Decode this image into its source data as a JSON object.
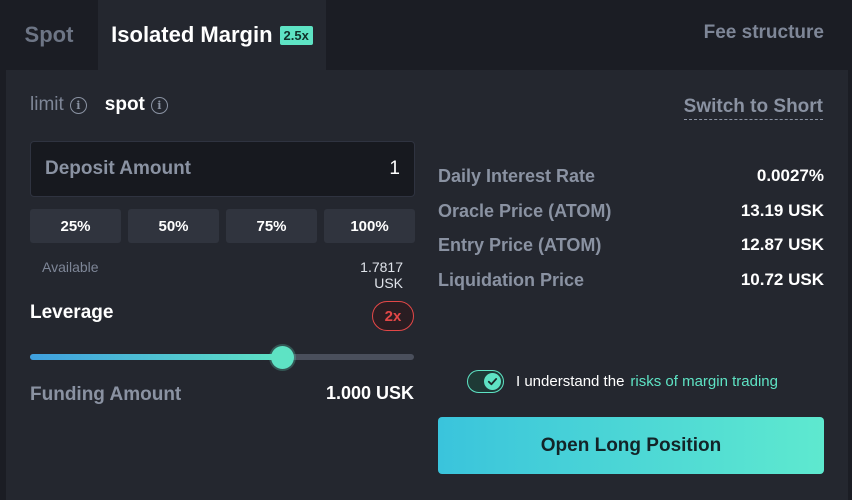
{
  "tabs": {
    "spot": "Spot",
    "isolated_margin": "Isolated Margin",
    "margin_badge": "2.5x",
    "fee_structure": "Fee structure"
  },
  "order_modes": {
    "limit": "limit",
    "spot": "spot",
    "active": "spot"
  },
  "switch_link": "Switch to Short",
  "deposit": {
    "label": "Deposit Amount",
    "value": "1"
  },
  "percent_buttons": [
    "25%",
    "50%",
    "75%",
    "100%"
  ],
  "available": {
    "label": "Available",
    "value": "1.7817 USK"
  },
  "leverage": {
    "label": "Leverage",
    "value_label": "2x",
    "slider_fraction": 0.655
  },
  "funding": {
    "label": "Funding Amount",
    "value": "1.000 USK"
  },
  "stats": [
    {
      "label": "Daily Interest Rate",
      "value": "0.0027%"
    },
    {
      "label": "Oracle Price (ATOM)",
      "value": "13.19 USK"
    },
    {
      "label": "Entry Price (ATOM)",
      "value": "12.87 USK"
    },
    {
      "label": "Liquidation Price",
      "value": "10.72 USK"
    }
  ],
  "risk": {
    "text": "I understand the",
    "link": "risks of margin trading",
    "checked": true
  },
  "submit_label": "Open Long Position",
  "colors": {
    "accent": "#5ee3c4",
    "danger": "#e34747",
    "panel": "#24272f",
    "background": "#1b1d24"
  },
  "icons": {
    "info": "info-circle-icon",
    "check": "check-icon"
  }
}
